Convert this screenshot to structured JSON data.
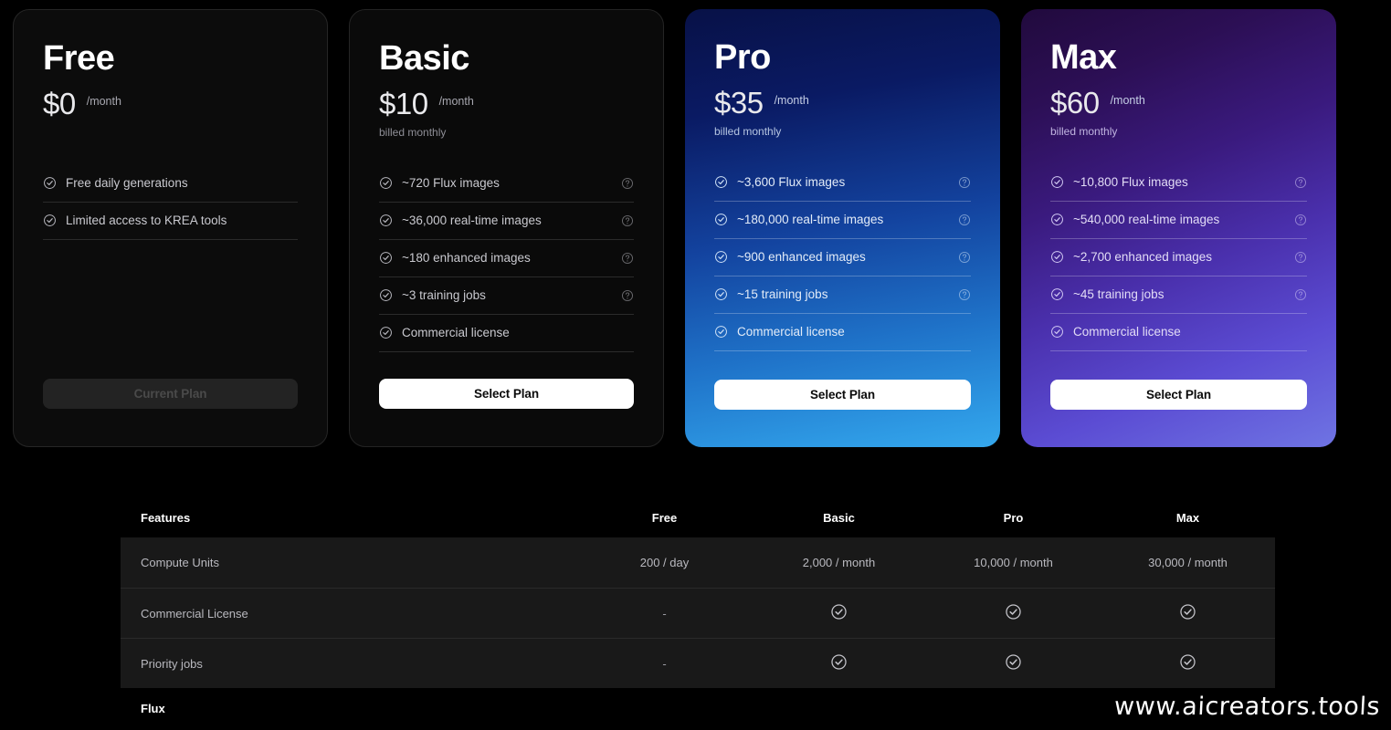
{
  "plans": [
    {
      "name": "Free",
      "price": "$0",
      "period": "/month",
      "billed": "",
      "cta": "Current Plan",
      "cta_type": "current",
      "features": [
        {
          "text": "Free daily generations",
          "help": false
        },
        {
          "text": "Limited access to KREA tools",
          "help": false
        }
      ]
    },
    {
      "name": "Basic",
      "price": "$10",
      "period": "/month",
      "billed": "billed monthly",
      "cta": "Select Plan",
      "cta_type": "select",
      "features": [
        {
          "text": "~720 Flux images",
          "help": true
        },
        {
          "text": "~36,000 real-time images",
          "help": true
        },
        {
          "text": "~180 enhanced images",
          "help": true
        },
        {
          "text": "~3 training jobs",
          "help": true
        },
        {
          "text": "Commercial license",
          "help": false
        }
      ]
    },
    {
      "name": "Pro",
      "price": "$35",
      "period": "/month",
      "billed": "billed monthly",
      "cta": "Select Plan",
      "cta_type": "select",
      "features": [
        {
          "text": "~3,600 Flux images",
          "help": true
        },
        {
          "text": "~180,000 real-time images",
          "help": true
        },
        {
          "text": "~900 enhanced images",
          "help": true
        },
        {
          "text": "~15 training jobs",
          "help": true
        },
        {
          "text": "Commercial license",
          "help": false
        }
      ]
    },
    {
      "name": "Max",
      "price": "$60",
      "period": "/month",
      "billed": "billed monthly",
      "cta": "Select Plan",
      "cta_type": "select",
      "features": [
        {
          "text": "~10,800 Flux images",
          "help": true
        },
        {
          "text": "~540,000 real-time images",
          "help": true
        },
        {
          "text": "~2,700 enhanced images",
          "help": true
        },
        {
          "text": "~45 training jobs",
          "help": true
        },
        {
          "text": "Commercial license",
          "help": false
        }
      ]
    }
  ],
  "comparison": {
    "headers": [
      "Features",
      "Free",
      "Basic",
      "Pro",
      "Max"
    ],
    "rows": [
      {
        "type": "data",
        "label": "Compute Units",
        "values": [
          "200 / day",
          "2,000 / month",
          "10,000 / month",
          "30,000 / month"
        ]
      },
      {
        "type": "data",
        "label": "Commercial License",
        "values": [
          "-",
          "check",
          "check",
          "check"
        ]
      },
      {
        "type": "data",
        "label": "Priority jobs",
        "values": [
          "-",
          "check",
          "check",
          "check"
        ]
      },
      {
        "type": "section",
        "label": "Flux",
        "values": [
          "",
          "",
          "",
          ""
        ]
      }
    ]
  },
  "watermark": "www.aicreators.tools",
  "colors": {
    "page_background": "#000000",
    "card_dark": "#0c0c0c",
    "pro_gradient_start": "#081147",
    "pro_gradient_end": "#35a7ec",
    "max_gradient_start": "#210a3d",
    "max_gradient_end": "#6f74e3",
    "cta_select_bg": "#ffffff",
    "cta_current_bg": "#232323",
    "table_row_bg": "#191919"
  },
  "icons": {
    "check_circle": "check-circle-icon",
    "help_circle": "question-circle-icon"
  }
}
